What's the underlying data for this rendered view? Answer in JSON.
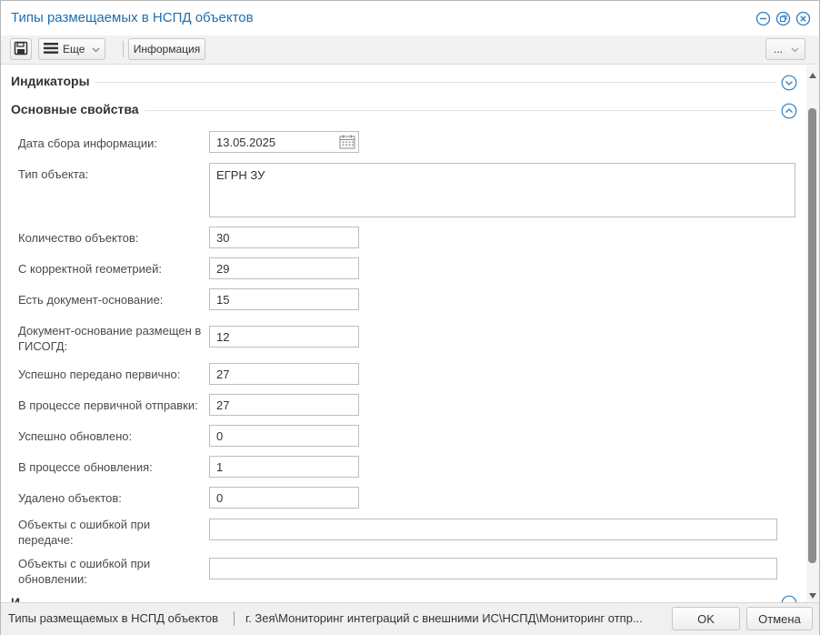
{
  "window": {
    "title": "Типы размещаемых в НСПД объектов",
    "accent_color": "#1f6fb0",
    "controls": [
      "minimize-icon",
      "restore-icon",
      "close-icon"
    ]
  },
  "toolbar": {
    "save_icon": "save-icon",
    "more_label": "Еще",
    "info_label": "Информация",
    "extra_label": "..."
  },
  "sections": {
    "indicators": {
      "title": "Индикаторы",
      "state": "collapsed"
    },
    "main": {
      "title": "Основные свойства",
      "state": "expanded"
    },
    "next_partial": {
      "title": "И"
    }
  },
  "fields": {
    "date": {
      "label": "Дата сбора информации:",
      "value": "13.05.2025"
    },
    "object_type": {
      "label": "Тип объекта:",
      "value": "ЕГРН ЗУ"
    },
    "count": {
      "label": "Количество объектов:",
      "value": "30"
    },
    "correct_geometry": {
      "label": "С корректной геометрией:",
      "value": "29"
    },
    "has_doc": {
      "label": "Есть документ-основание:",
      "value": "15"
    },
    "doc_in_gisogd": {
      "label": "Документ-основание размещен в ГИСОГД:",
      "value": "12"
    },
    "sent_initial": {
      "label": "Успешно передано первично:",
      "value": "27"
    },
    "sending_initial": {
      "label": "В процессе первичной отправки:",
      "value": "27"
    },
    "updated": {
      "label": "Успешно обновлено:",
      "value": "0"
    },
    "updating": {
      "label": "В процессе обновления:",
      "value": "1"
    },
    "deleted": {
      "label": "Удалено объектов:",
      "value": "0"
    },
    "errors_transfer": {
      "label": "Объекты с ошибкой при передаче:",
      "value": ""
    },
    "errors_update": {
      "label": "Объекты с ошибкой при обновлении:",
      "value": ""
    }
  },
  "statusbar": {
    "form_name": "Типы размещаемых в НСПД объектов",
    "path": "г. Зея\\Мониторинг интеграций с внешними ИС\\НСПД\\Мониторинг отпр...",
    "ok_label": "OK",
    "cancel_label": "Отмена"
  }
}
